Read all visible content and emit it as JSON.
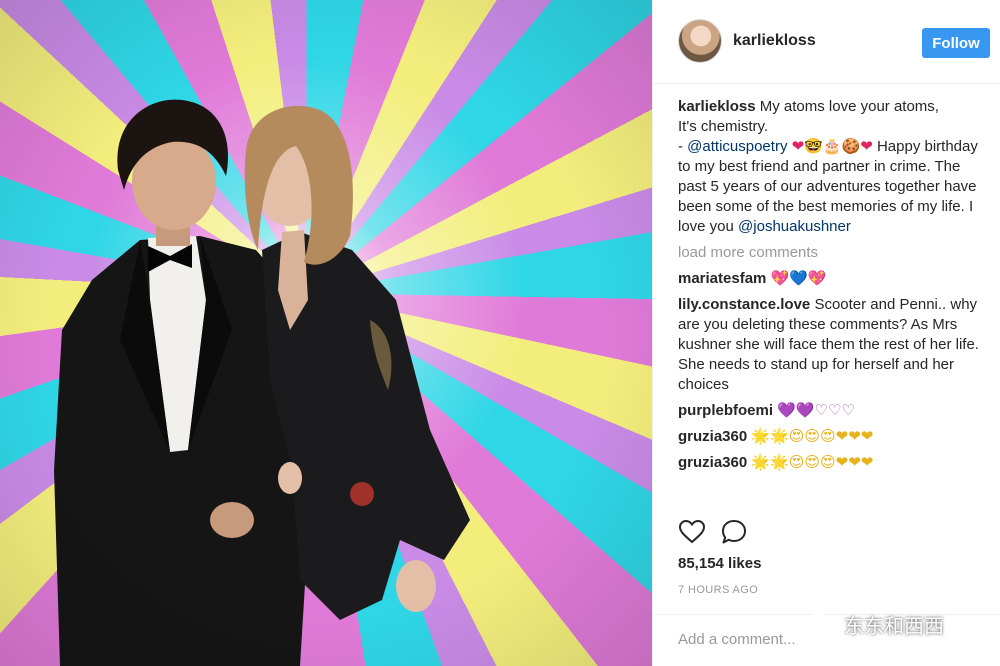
{
  "post": {
    "username": "karliekloss",
    "follow_label": "Follow",
    "caption": {
      "username": "karliekloss",
      "line1": "My atoms love your atoms,",
      "line2": "It's chemistry.",
      "dash": "- ",
      "mention1": "@atticuspoetry",
      "emoji": "❤🤓🎂🍪❤",
      "text": " Happy birthday to my best friend and partner in crime. The past 5 years of our adventures together have been some of the best memories of my life. I love you ",
      "mention2": "@joshuakushner"
    },
    "load_more": "load more comments",
    "comments": [
      {
        "username": "mariatesfam",
        "text": " ",
        "emoji": "💖💙💖"
      },
      {
        "username": "lily.constance.love",
        "text": " Scooter and Penni.. why are you deleting these comments? As Mrs kushner she will face them the rest of her life. She needs to stand up for herself and her choices",
        "emoji": ""
      },
      {
        "username": "purplebfoemi",
        "text": " ",
        "emoji": "💜💜♡♡♡"
      },
      {
        "username": "gruzia360",
        "text": " ",
        "emoji": "🌟🌟😍😍😍❤❤❤"
      },
      {
        "username": "gruzia360",
        "text": " ",
        "emoji": "🌟🌟😍😍😍❤❤❤"
      }
    ],
    "likes": "85,154 likes",
    "timestamp": "7 HOURS AGO",
    "add_comment_placeholder": "Add a comment..."
  },
  "watermark": {
    "text": "东东和西西"
  },
  "icons": {
    "like": "heart-outline-icon",
    "comment": "comment-bubble-icon",
    "watermark_logo": "wechat-logo"
  },
  "colors": {
    "follow_button": "#3897f0",
    "mention": "#003569",
    "muted": "#999999",
    "text": "#262626"
  }
}
